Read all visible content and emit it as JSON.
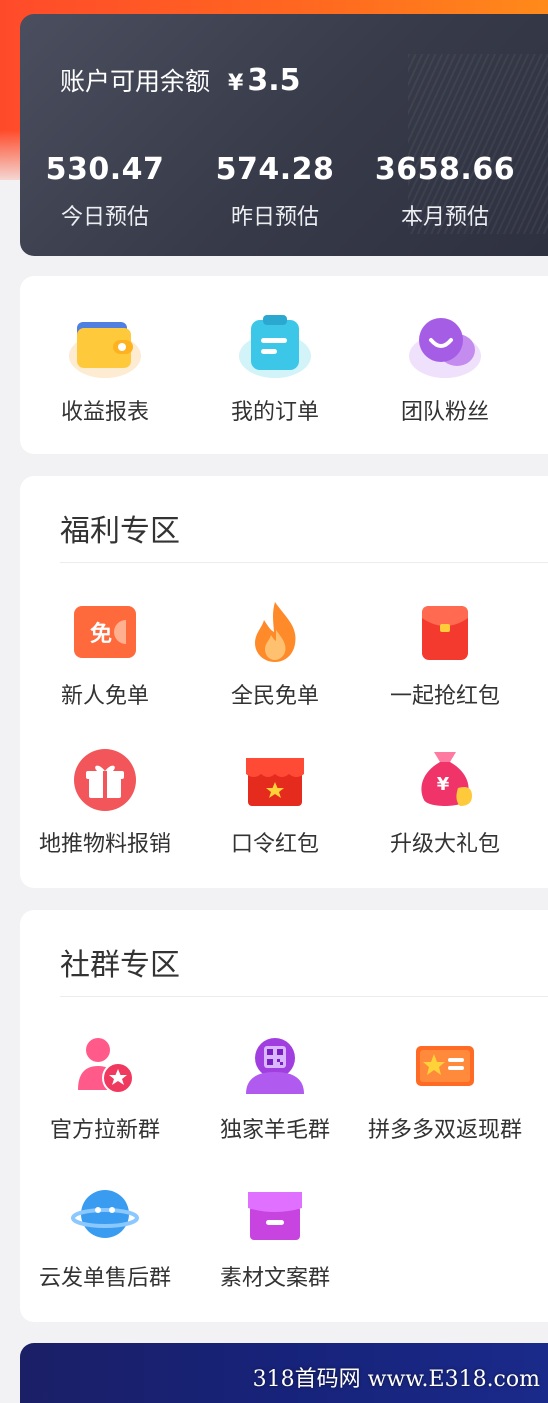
{
  "account": {
    "title": "账户可用余额",
    "currency": "¥",
    "balance": "3.5",
    "stats": [
      {
        "value": "530.47",
        "label": "今日预估"
      },
      {
        "value": "574.28",
        "label": "昨日预估"
      },
      {
        "value": "3658.66",
        "label": "本月预估"
      }
    ]
  },
  "quick_menu": [
    {
      "label": "收益报表",
      "icon": "wallet-icon"
    },
    {
      "label": "我的订单",
      "icon": "clipboard-icon"
    },
    {
      "label": "团队粉丝",
      "icon": "chat-bubbles-icon"
    }
  ],
  "welfare": {
    "title": "福利专区",
    "items": [
      {
        "label": "新人免单",
        "icon": "free-ticket-icon",
        "badge": "免"
      },
      {
        "label": "全民免单",
        "icon": "flame-icon"
      },
      {
        "label": "一起抢红包",
        "icon": "red-envelope-icon"
      },
      {
        "label": "地推物料报销",
        "icon": "gift-box-icon"
      },
      {
        "label": "口令红包",
        "icon": "shop-star-icon"
      },
      {
        "label": "升级大礼包",
        "icon": "money-bag-icon",
        "badge": "¥"
      }
    ]
  },
  "community": {
    "title": "社群专区",
    "items": [
      {
        "label": "官方拉新群",
        "icon": "user-star-icon"
      },
      {
        "label": "独家羊毛群",
        "icon": "qr-user-icon"
      },
      {
        "label": "拼多多双返现群",
        "icon": "coupon-star-icon"
      },
      {
        "label": "云发单售后群",
        "icon": "planet-face-icon"
      },
      {
        "label": "素材文案群",
        "icon": "store-icon"
      }
    ]
  },
  "watermark": "318首码网 www.E318.com",
  "colors": {
    "accent_orange": "#ff5a24",
    "card_dark": "#3a3d4b"
  }
}
